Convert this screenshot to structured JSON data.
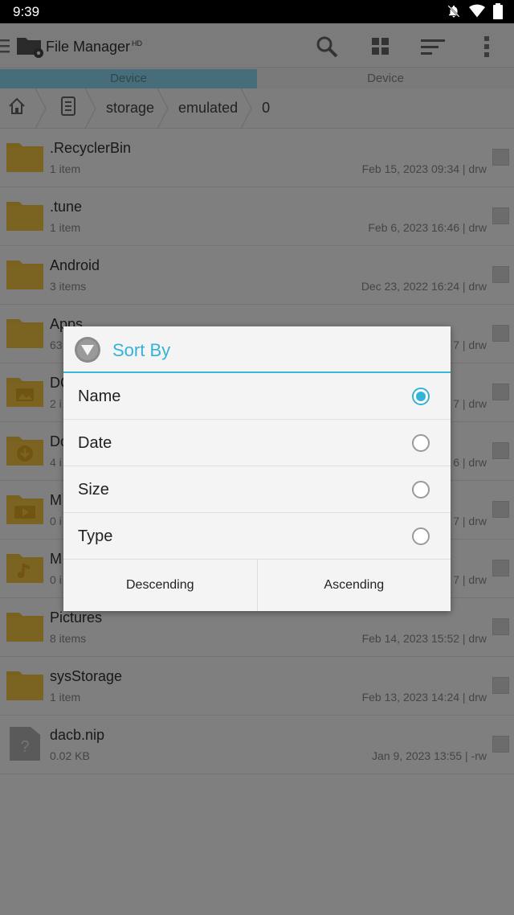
{
  "status_bar": {
    "time": "9:39",
    "icons": [
      "notifications-off-icon",
      "wifi-icon",
      "battery-icon"
    ]
  },
  "app_bar": {
    "title": "File Manager",
    "title_badge": "HD",
    "actions": [
      "search-icon",
      "grid-view-icon",
      "sort-icon",
      "overflow-menu-icon"
    ]
  },
  "tabs": [
    {
      "label": "Device",
      "active": true
    },
    {
      "label": "Device",
      "active": false
    }
  ],
  "breadcrumb": {
    "items": [
      "storage",
      "emulated",
      "0"
    ]
  },
  "files": [
    {
      "name": ".RecyclerBin",
      "count": "1 item",
      "meta": "Feb 15, 2023 09:34 | drw",
      "type": "folder"
    },
    {
      "name": ".tune",
      "count": "1 item",
      "meta": "Feb 6, 2023 16:46 | drw",
      "type": "folder"
    },
    {
      "name": "Android",
      "count": "3 items",
      "meta": "Dec 23, 2022 16:24 | drw",
      "type": "folder"
    },
    {
      "name": "Apps",
      "count": "63",
      "meta": "7 | drw",
      "type": "folder"
    },
    {
      "name": "DC",
      "count": "2 i",
      "meta": "7 | drw",
      "type": "folder-image"
    },
    {
      "name": "Do",
      "count": "4 i",
      "meta": "6 | drw",
      "type": "folder-download"
    },
    {
      "name": "M",
      "count": "0 i",
      "meta": "7 | drw",
      "type": "folder-video"
    },
    {
      "name": "M",
      "count": "0 i",
      "meta": "7 | drw",
      "type": "folder-music"
    },
    {
      "name": "Pictures",
      "count": "8 items",
      "meta": "Feb 14, 2023 15:52 | drw",
      "type": "folder"
    },
    {
      "name": "sysStorage",
      "count": "1 item",
      "meta": "Feb 13, 2023 14:24 | drw",
      "type": "folder"
    },
    {
      "name": "dacb.nip",
      "count": "0.02 KB",
      "meta": "Jan 9, 2023 13:55 | -rw",
      "type": "file"
    }
  ],
  "dialog": {
    "title": "Sort By",
    "options": [
      {
        "label": "Name",
        "selected": true
      },
      {
        "label": "Date",
        "selected": false
      },
      {
        "label": "Size",
        "selected": false
      },
      {
        "label": "Type",
        "selected": false
      }
    ],
    "buttons": {
      "descending": "Descending",
      "ascending": "Ascending"
    }
  },
  "colors": {
    "accent": "#35b2d8",
    "folder": "#f6c744",
    "tab_active": "#8fdaf4"
  }
}
